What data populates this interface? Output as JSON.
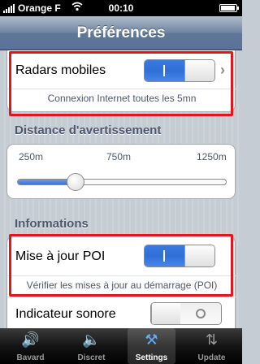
{
  "status_bar": {
    "carrier": "Orange F",
    "time": "00:10"
  },
  "navbar": {
    "title": "Préférences"
  },
  "group1": {
    "row_label": "Radars mobiles",
    "toggle_state": "on",
    "subtitle": "Connexion Internet toutes les 5mn"
  },
  "distance_section": {
    "title": "Distance d'avertissement",
    "labels": [
      "250m",
      "750m",
      "1250m"
    ],
    "slider_value_fraction": 0.28
  },
  "informations_section": {
    "title": "Informations",
    "poi_row_label": "Mise à jour POI",
    "poi_toggle_state": "on",
    "poi_subtitle": "Vérifier les mises à jour au démarrage (POI)",
    "sound_row_label": "Indicateur sonore",
    "sound_toggle_state": "off"
  },
  "tabbar": {
    "tabs": [
      {
        "label": "Bavard",
        "icon": "speaker-loud-icon",
        "active": false
      },
      {
        "label": "Discret",
        "icon": "speaker-quiet-icon",
        "active": false
      },
      {
        "label": "Settings",
        "icon": "tools-icon",
        "active": true
      },
      {
        "label": "Update",
        "icon": "refresh-icon",
        "active": false
      }
    ]
  },
  "colors": {
    "highlight": "#e8141c",
    "toggle_on": "#3a7ae0",
    "section_text": "#4c566c"
  }
}
